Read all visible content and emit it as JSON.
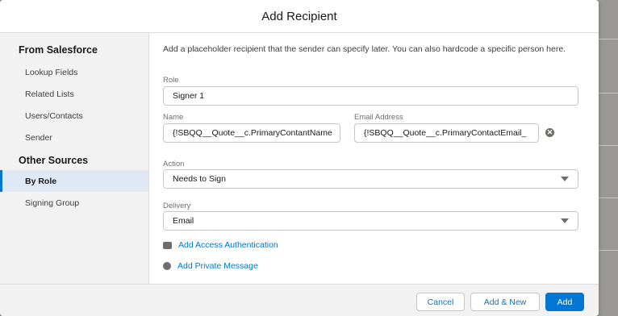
{
  "modal": {
    "title": "Add Recipient"
  },
  "sidebar": {
    "section1": "From Salesforce",
    "items1": [
      "Lookup Fields",
      "Related Lists",
      "Users/Contacts",
      "Sender"
    ],
    "section2": "Other Sources",
    "items2": [
      "By Role",
      "Signing Group"
    ]
  },
  "content": {
    "description": "Add a placeholder recipient that the sender can specify later. You can also hardcode a specific person here.",
    "role": {
      "label": "Role",
      "value": "Signer 1"
    },
    "name": {
      "label": "Name",
      "value": "{!SBQQ__Quote__c.PrimaryContantName"
    },
    "email": {
      "label": "Email Address",
      "value": "{!SBQQ__Quote__c.PrimaryContactEmail_"
    },
    "action": {
      "label": "Action",
      "value": "Needs to Sign"
    },
    "delivery": {
      "label": "Delivery",
      "value": "Email"
    },
    "access_auth": "Add Access Authentication",
    "private_msg": "Add Private Message"
  },
  "footer": {
    "cancel": "Cancel",
    "add_new": "Add & New",
    "add": "Add"
  }
}
